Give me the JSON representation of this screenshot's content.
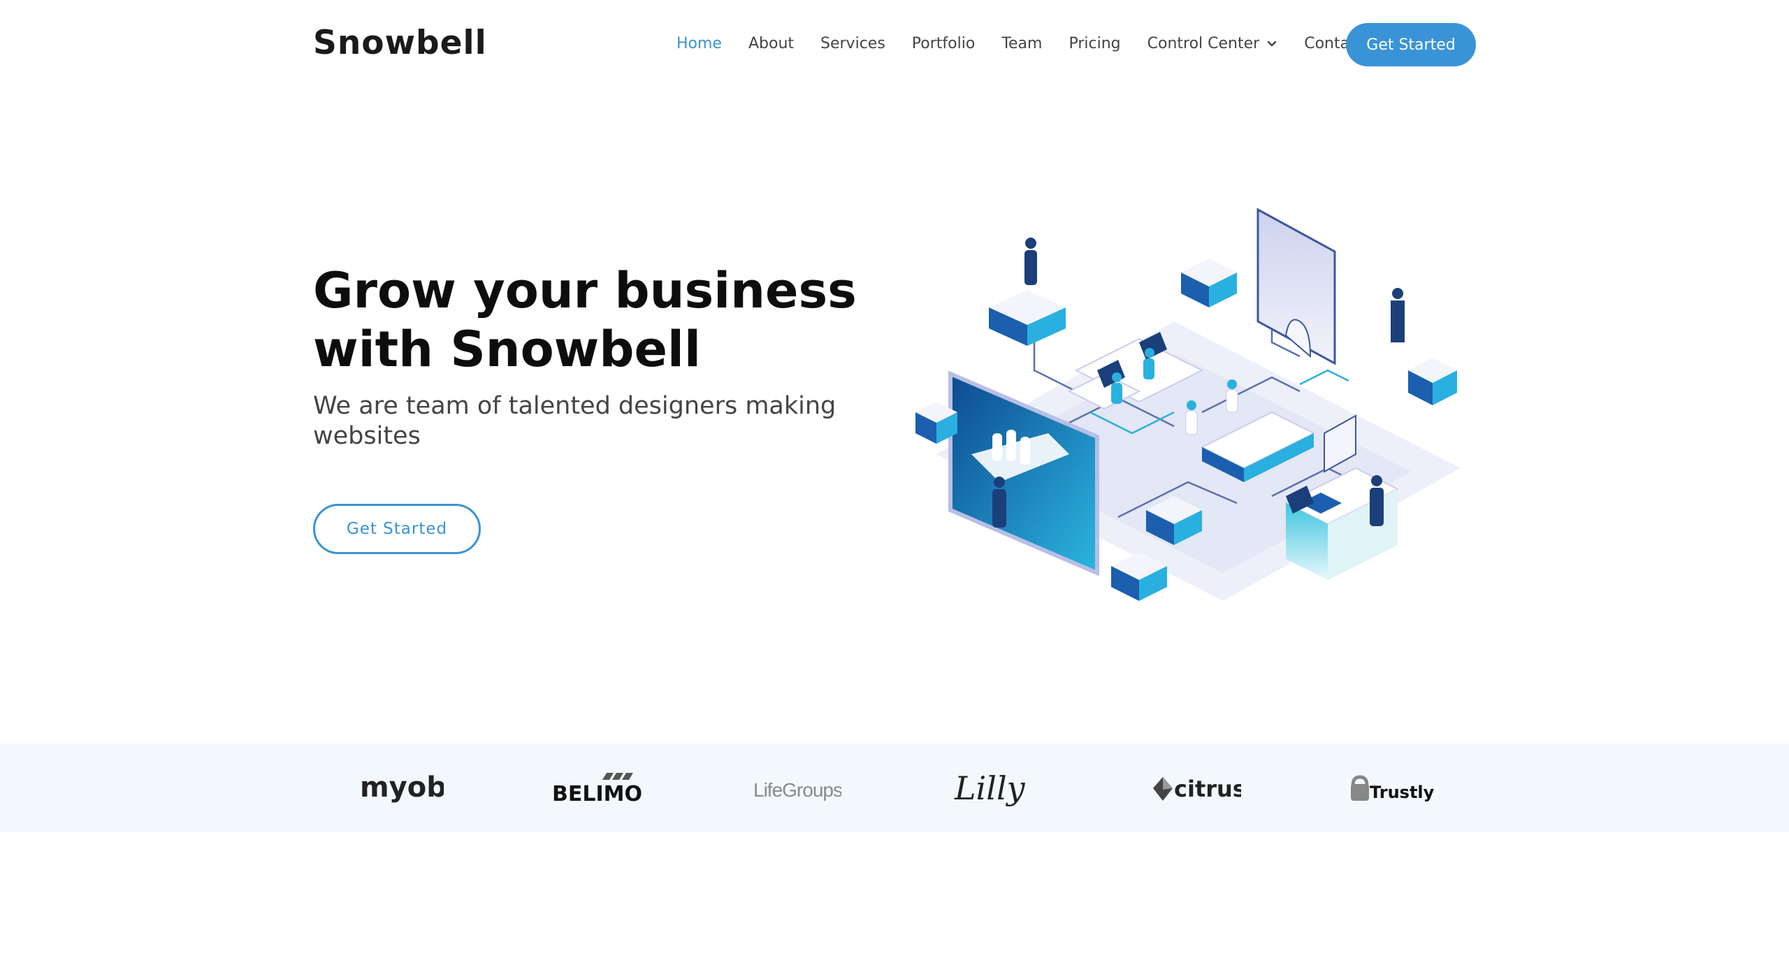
{
  "header": {
    "logo": "Snowbell",
    "nav": [
      {
        "label": "Home",
        "active": true
      },
      {
        "label": "About"
      },
      {
        "label": "Services"
      },
      {
        "label": "Portfolio"
      },
      {
        "label": "Team"
      },
      {
        "label": "Pricing"
      },
      {
        "label": "Control Center",
        "dropdown": true
      },
      {
        "label": "Contact"
      }
    ],
    "cta": "Get Started"
  },
  "hero": {
    "title_line1": "Grow your business",
    "title_line2": "with Snowbell",
    "subtitle": "We are team of talented designers making websites",
    "cta": "Get Started"
  },
  "clients": {
    "logos": [
      "myob",
      "BELIMO",
      "LifeGroups",
      "Lilly",
      "citrus",
      "Trustly"
    ]
  },
  "colors": {
    "accent": "#3a93d6",
    "strip_bg": "#f3f8fc",
    "text_dark": "#0d0d0d"
  }
}
